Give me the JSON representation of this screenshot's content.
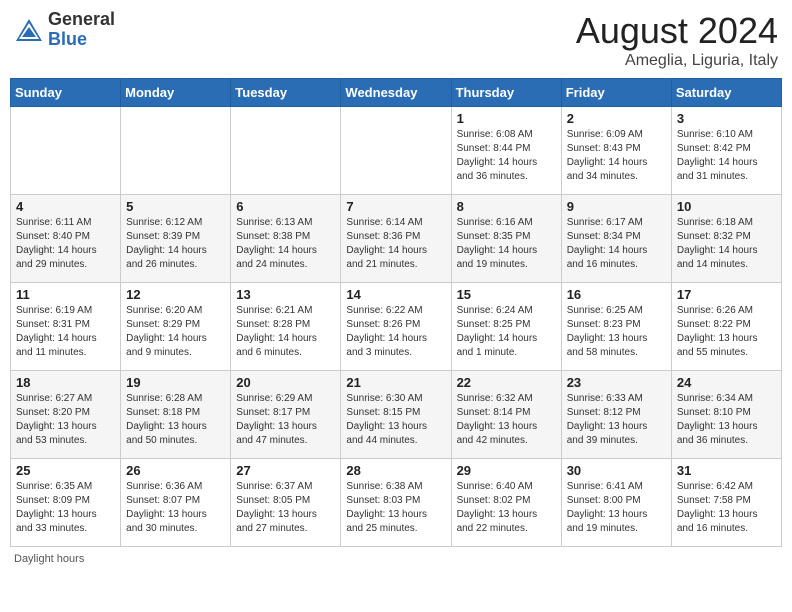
{
  "logo": {
    "general": "General",
    "blue": "Blue"
  },
  "header": {
    "month_year": "August 2024",
    "location": "Ameglia, Liguria, Italy"
  },
  "weekdays": [
    "Sunday",
    "Monday",
    "Tuesday",
    "Wednesday",
    "Thursday",
    "Friday",
    "Saturday"
  ],
  "weeks": [
    [
      null,
      null,
      null,
      null,
      {
        "day": 1,
        "sunrise": "Sunrise: 6:08 AM",
        "sunset": "Sunset: 8:44 PM",
        "daylight": "Daylight: 14 hours and 36 minutes."
      },
      {
        "day": 2,
        "sunrise": "Sunrise: 6:09 AM",
        "sunset": "Sunset: 8:43 PM",
        "daylight": "Daylight: 14 hours and 34 minutes."
      },
      {
        "day": 3,
        "sunrise": "Sunrise: 6:10 AM",
        "sunset": "Sunset: 8:42 PM",
        "daylight": "Daylight: 14 hours and 31 minutes."
      }
    ],
    [
      {
        "day": 4,
        "sunrise": "Sunrise: 6:11 AM",
        "sunset": "Sunset: 8:40 PM",
        "daylight": "Daylight: 14 hours and 29 minutes."
      },
      {
        "day": 5,
        "sunrise": "Sunrise: 6:12 AM",
        "sunset": "Sunset: 8:39 PM",
        "daylight": "Daylight: 14 hours and 26 minutes."
      },
      {
        "day": 6,
        "sunrise": "Sunrise: 6:13 AM",
        "sunset": "Sunset: 8:38 PM",
        "daylight": "Daylight: 14 hours and 24 minutes."
      },
      {
        "day": 7,
        "sunrise": "Sunrise: 6:14 AM",
        "sunset": "Sunset: 8:36 PM",
        "daylight": "Daylight: 14 hours and 21 minutes."
      },
      {
        "day": 8,
        "sunrise": "Sunrise: 6:16 AM",
        "sunset": "Sunset: 8:35 PM",
        "daylight": "Daylight: 14 hours and 19 minutes."
      },
      {
        "day": 9,
        "sunrise": "Sunrise: 6:17 AM",
        "sunset": "Sunset: 8:34 PM",
        "daylight": "Daylight: 14 hours and 16 minutes."
      },
      {
        "day": 10,
        "sunrise": "Sunrise: 6:18 AM",
        "sunset": "Sunset: 8:32 PM",
        "daylight": "Daylight: 14 hours and 14 minutes."
      }
    ],
    [
      {
        "day": 11,
        "sunrise": "Sunrise: 6:19 AM",
        "sunset": "Sunset: 8:31 PM",
        "daylight": "Daylight: 14 hours and 11 minutes."
      },
      {
        "day": 12,
        "sunrise": "Sunrise: 6:20 AM",
        "sunset": "Sunset: 8:29 PM",
        "daylight": "Daylight: 14 hours and 9 minutes."
      },
      {
        "day": 13,
        "sunrise": "Sunrise: 6:21 AM",
        "sunset": "Sunset: 8:28 PM",
        "daylight": "Daylight: 14 hours and 6 minutes."
      },
      {
        "day": 14,
        "sunrise": "Sunrise: 6:22 AM",
        "sunset": "Sunset: 8:26 PM",
        "daylight": "Daylight: 14 hours and 3 minutes."
      },
      {
        "day": 15,
        "sunrise": "Sunrise: 6:24 AM",
        "sunset": "Sunset: 8:25 PM",
        "daylight": "Daylight: 14 hours and 1 minute."
      },
      {
        "day": 16,
        "sunrise": "Sunrise: 6:25 AM",
        "sunset": "Sunset: 8:23 PM",
        "daylight": "Daylight: 13 hours and 58 minutes."
      },
      {
        "day": 17,
        "sunrise": "Sunrise: 6:26 AM",
        "sunset": "Sunset: 8:22 PM",
        "daylight": "Daylight: 13 hours and 55 minutes."
      }
    ],
    [
      {
        "day": 18,
        "sunrise": "Sunrise: 6:27 AM",
        "sunset": "Sunset: 8:20 PM",
        "daylight": "Daylight: 13 hours and 53 minutes."
      },
      {
        "day": 19,
        "sunrise": "Sunrise: 6:28 AM",
        "sunset": "Sunset: 8:18 PM",
        "daylight": "Daylight: 13 hours and 50 minutes."
      },
      {
        "day": 20,
        "sunrise": "Sunrise: 6:29 AM",
        "sunset": "Sunset: 8:17 PM",
        "daylight": "Daylight: 13 hours and 47 minutes."
      },
      {
        "day": 21,
        "sunrise": "Sunrise: 6:30 AM",
        "sunset": "Sunset: 8:15 PM",
        "daylight": "Daylight: 13 hours and 44 minutes."
      },
      {
        "day": 22,
        "sunrise": "Sunrise: 6:32 AM",
        "sunset": "Sunset: 8:14 PM",
        "daylight": "Daylight: 13 hours and 42 minutes."
      },
      {
        "day": 23,
        "sunrise": "Sunrise: 6:33 AM",
        "sunset": "Sunset: 8:12 PM",
        "daylight": "Daylight: 13 hours and 39 minutes."
      },
      {
        "day": 24,
        "sunrise": "Sunrise: 6:34 AM",
        "sunset": "Sunset: 8:10 PM",
        "daylight": "Daylight: 13 hours and 36 minutes."
      }
    ],
    [
      {
        "day": 25,
        "sunrise": "Sunrise: 6:35 AM",
        "sunset": "Sunset: 8:09 PM",
        "daylight": "Daylight: 13 hours and 33 minutes."
      },
      {
        "day": 26,
        "sunrise": "Sunrise: 6:36 AM",
        "sunset": "Sunset: 8:07 PM",
        "daylight": "Daylight: 13 hours and 30 minutes."
      },
      {
        "day": 27,
        "sunrise": "Sunrise: 6:37 AM",
        "sunset": "Sunset: 8:05 PM",
        "daylight": "Daylight: 13 hours and 27 minutes."
      },
      {
        "day": 28,
        "sunrise": "Sunrise: 6:38 AM",
        "sunset": "Sunset: 8:03 PM",
        "daylight": "Daylight: 13 hours and 25 minutes."
      },
      {
        "day": 29,
        "sunrise": "Sunrise: 6:40 AM",
        "sunset": "Sunset: 8:02 PM",
        "daylight": "Daylight: 13 hours and 22 minutes."
      },
      {
        "day": 30,
        "sunrise": "Sunrise: 6:41 AM",
        "sunset": "Sunset: 8:00 PM",
        "daylight": "Daylight: 13 hours and 19 minutes."
      },
      {
        "day": 31,
        "sunrise": "Sunrise: 6:42 AM",
        "sunset": "Sunset: 7:58 PM",
        "daylight": "Daylight: 13 hours and 16 minutes."
      }
    ]
  ],
  "footer": {
    "note": "Daylight hours"
  }
}
